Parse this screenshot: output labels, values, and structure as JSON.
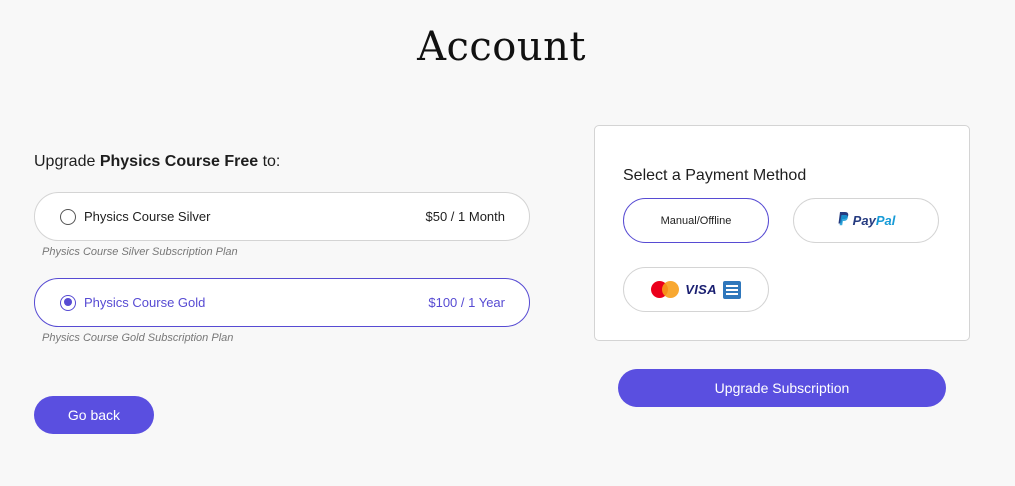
{
  "page": {
    "title": "Account"
  },
  "upgrade": {
    "prefix": "Upgrade ",
    "course": "Physics Course Free",
    "suffix": " to:"
  },
  "plans": [
    {
      "name": "Physics Course Silver",
      "price": "$50 / 1 Month",
      "description": "Physics Course Silver Subscription Plan",
      "selected": false
    },
    {
      "name": "Physics Course Gold",
      "price": "$100 / 1 Year",
      "description": "Physics Course Gold Subscription Plan",
      "selected": true
    }
  ],
  "actions": {
    "go_back": "Go back",
    "upgrade_subscription": "Upgrade Subscription"
  },
  "payment": {
    "heading": "Select a Payment Method",
    "methods": {
      "manual": {
        "label": "Manual/Offline",
        "selected": true
      },
      "paypal": {
        "label_pay": "Pay",
        "label_pal": "Pal",
        "icon": "paypal-icon"
      },
      "cards": {
        "label_visa": "VISA",
        "icons": [
          "mastercard-icon",
          "visa-icon",
          "amex-icon"
        ]
      }
    }
  },
  "colors": {
    "accent": "#574bd3",
    "button": "#5a4fe0",
    "paypal_dark": "#253b80",
    "paypal_light": "#179bd7"
  }
}
